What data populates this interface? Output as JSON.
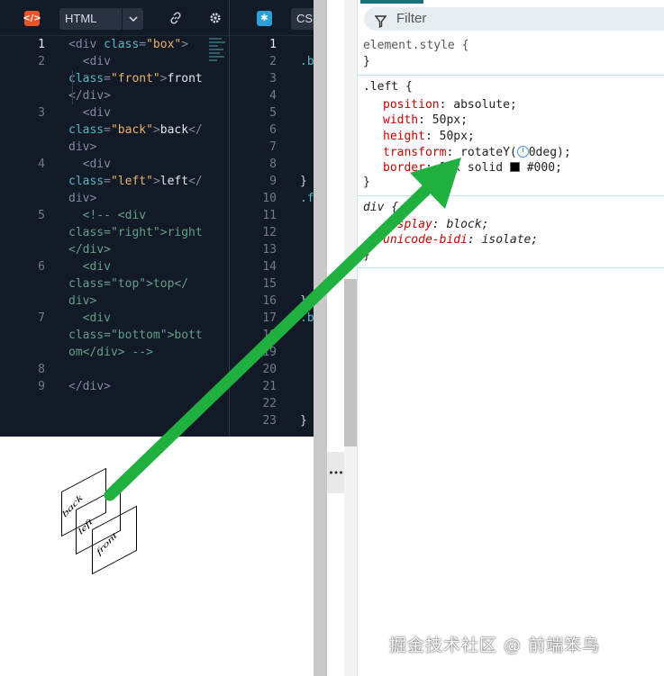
{
  "html_editor": {
    "language": "HTML",
    "lines": [
      {
        "n": "1",
        "parts": [
          [
            "tag",
            "<div "
          ],
          [
            "attr",
            "class"
          ],
          [
            "tag",
            "="
          ],
          [
            "str",
            "\"box\""
          ],
          [
            "tag",
            ">"
          ]
        ]
      },
      {
        "n": "2",
        "parts": [
          [
            "tag",
            "  <div"
          ]
        ]
      },
      {
        "n": "",
        "parts": [
          [
            "attr",
            "class"
          ],
          [
            "tag",
            "="
          ],
          [
            "str",
            "\"front\""
          ],
          [
            "tag",
            ">"
          ],
          [
            "txt",
            "front"
          ]
        ]
      },
      {
        "n": "",
        "parts": [
          [
            "tag",
            "</div>"
          ]
        ]
      },
      {
        "n": "3",
        "parts": [
          [
            "tag",
            "  <div"
          ]
        ]
      },
      {
        "n": "",
        "parts": [
          [
            "attr",
            "class"
          ],
          [
            "tag",
            "="
          ],
          [
            "str",
            "\"back\""
          ],
          [
            "tag",
            ">"
          ],
          [
            "txt",
            "back"
          ],
          [
            "tag",
            "</"
          ]
        ]
      },
      {
        "n": "",
        "parts": [
          [
            "tag",
            "div>"
          ]
        ]
      },
      {
        "n": "4",
        "parts": [
          [
            "tag",
            "  <div"
          ]
        ]
      },
      {
        "n": "",
        "parts": [
          [
            "attr",
            "class"
          ],
          [
            "tag",
            "="
          ],
          [
            "str",
            "\"left\""
          ],
          [
            "tag",
            ">"
          ],
          [
            "txt",
            "left"
          ],
          [
            "tag",
            "</"
          ]
        ]
      },
      {
        "n": "",
        "parts": [
          [
            "tag",
            "div>"
          ]
        ]
      },
      {
        "n": "5",
        "parts": [
          [
            "cmt",
            "  <!-- <div"
          ]
        ]
      },
      {
        "n": "",
        "parts": [
          [
            "cmt",
            "class=\"right\">right"
          ]
        ]
      },
      {
        "n": "",
        "parts": [
          [
            "cmt",
            "</div>"
          ]
        ]
      },
      {
        "n": "6",
        "parts": [
          [
            "cmt",
            "  <div"
          ]
        ]
      },
      {
        "n": "",
        "parts": [
          [
            "cmt",
            "class=\"top\">top</"
          ]
        ]
      },
      {
        "n": "",
        "parts": [
          [
            "cmt",
            "div>"
          ]
        ]
      },
      {
        "n": "7",
        "parts": [
          [
            "cmt",
            "  <div"
          ]
        ]
      },
      {
        "n": "",
        "parts": [
          [
            "cmt",
            "class=\"bottom\">bott"
          ]
        ]
      },
      {
        "n": "",
        "parts": [
          [
            "cmt",
            "om</div> -->"
          ]
        ]
      },
      {
        "n": "8",
        "parts": []
      },
      {
        "n": "9",
        "parts": [
          [
            "tag",
            "</div>"
          ]
        ]
      }
    ]
  },
  "css_editor": {
    "language": "CSS",
    "line_numbers": [
      "1",
      "2",
      "3",
      "4",
      "5",
      "6",
      "7",
      "8",
      "9",
      "10",
      "11",
      "12",
      "13",
      "14",
      "15",
      "16",
      "17",
      "18",
      "19",
      "20",
      "21",
      "22",
      "23"
    ],
    "fragments": [
      ".b",
      "}",
      ".f",
      "}",
      ".b",
      "}"
    ]
  },
  "preview": {
    "faces": [
      "back",
      "left",
      "front"
    ]
  },
  "devtools": {
    "filter_placeholder": "Filter",
    "element_style": "element.style {",
    "element_style_close": "}",
    "left_rule": {
      "selector": ".left {",
      "props": [
        {
          "name": "position",
          "value": "absolute;"
        },
        {
          "name": "width",
          "value": "50px;"
        },
        {
          "name": "height",
          "value": "50px;"
        },
        {
          "name": "transform",
          "value_prefix": "rotateY(",
          "value_suffix": "0deg);"
        },
        {
          "name": "border",
          "value_prefix": "1px solid ",
          "value_suffix": "#000;"
        }
      ],
      "close": "}"
    },
    "div_rule": {
      "selector": "div {",
      "props": [
        {
          "name": "display",
          "value": "block;"
        },
        {
          "name": "unicode-bidi",
          "value": "isolate;"
        }
      ],
      "close": "}"
    }
  },
  "watermark": "掘金技术社区 @ 前端笨鸟",
  "colors": {
    "editor_bg": "#131a27",
    "arrow": "#1fb040"
  }
}
